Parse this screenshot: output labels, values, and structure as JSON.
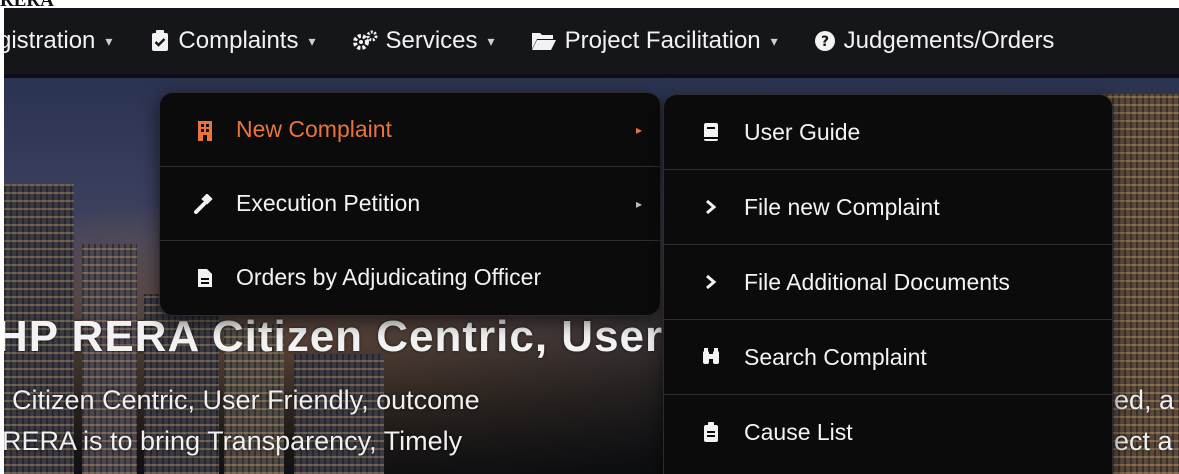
{
  "page_top_label": "RERA",
  "nav": {
    "registration": "gistration",
    "complaints": "Complaints",
    "services": "Services",
    "project_facilitation": "Project Facilitation",
    "judgements": "Judgements/Orders"
  },
  "complaints_menu": {
    "items": [
      {
        "label": "New Complaint",
        "icon": "building-icon",
        "active": true
      },
      {
        "label": "Execution Petition",
        "icon": "gavel-icon"
      },
      {
        "label": "Orders by Adjudicating Officer",
        "icon": "document-icon"
      }
    ]
  },
  "new_complaint_menu": {
    "items": [
      {
        "label": "User Guide",
        "icon": "book-icon"
      },
      {
        "label": "File new Complaint",
        "icon": "chevron-right-icon"
      },
      {
        "label": "File Additional Documents",
        "icon": "chevron-right-icon"
      },
      {
        "label": "Search Complaint",
        "icon": "binoculars-icon"
      },
      {
        "label": "Cause List",
        "icon": "clipboard-icon"
      }
    ]
  },
  "hero": {
    "headline": "HP RERA Citizen Centric, User Friendly Web-Portal",
    "line1": "Citizen Centric, User Friendly, outcome",
    "line1_right": "ed, a",
    "line2": "RERA is to bring Transparency, Timely",
    "line2_right": "ect a"
  },
  "colors": {
    "navbar": "#151619",
    "dropdown": "#0b0b0c",
    "active": "#e8743d",
    "text": "#f3f3f3"
  }
}
